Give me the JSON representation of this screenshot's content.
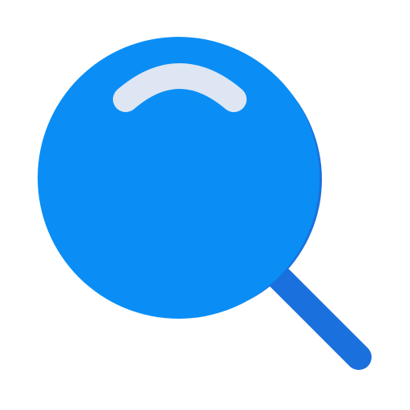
{
  "icon": {
    "name": "search-icon",
    "colors": {
      "lens_fill": "#0a8ef5",
      "lens_shadow": "#1a70dd",
      "handle": "#1a70dd",
      "highlight": "#dde6f2",
      "background": "#ffffff"
    }
  }
}
